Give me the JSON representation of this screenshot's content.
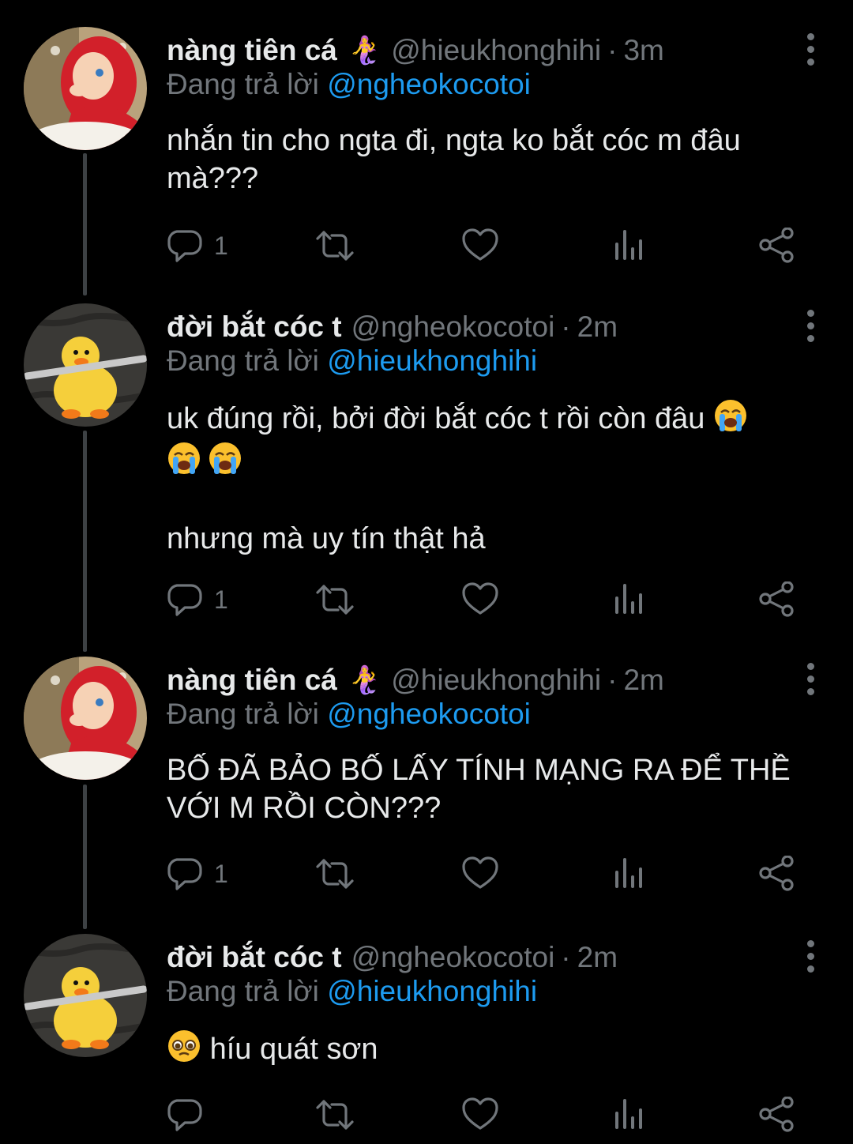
{
  "reply_label": "Đang trả lời",
  "tweets": [
    {
      "name": "nàng tiên cá",
      "badge": "🧜‍♀️",
      "handle": "@hieukhonghihi",
      "time": "3m",
      "reply_to": "@ngheokocotoi",
      "text1": "nhắn tin cho ngta đi, ngta ko bắt cóc m đâu",
      "text2": "mà???",
      "replies": "1"
    },
    {
      "name": "đời bắt cóc t",
      "handle": "@ngheokocotoi",
      "time": "2m",
      "reply_to": "@hieukhonghihi",
      "text1": "uk đúng rồi, bởi đời bắt cóc t rồi còn đâu",
      "emoji_icon": "loudly-crying-face",
      "text2": "nhưng mà uy tín thật hả",
      "replies": "1"
    },
    {
      "name": "nàng tiên cá",
      "badge": "🧜‍♀️",
      "handle": "@hieukhonghihi",
      "time": "2m",
      "reply_to": "@ngheokocotoi",
      "text1": "BỐ ĐÃ BẢO BỐ LẤY TÍNH MẠNG RA ĐỂ THỀ",
      "text2": "VỚI M RỒI CÒN???",
      "replies": "1"
    },
    {
      "name": "đời bắt cóc t",
      "handle": "@ngheokocotoi",
      "time": "2m",
      "reply_to": "@hieukhonghihi",
      "emoji_icon": "pleading-face",
      "text1": "híu quát sơn",
      "replies": ""
    }
  ],
  "colors": {
    "background": "#000000",
    "text": "#e7e9ea",
    "secondary": "#71767b",
    "link": "#1d9bf0",
    "thread": "#3d4144"
  }
}
